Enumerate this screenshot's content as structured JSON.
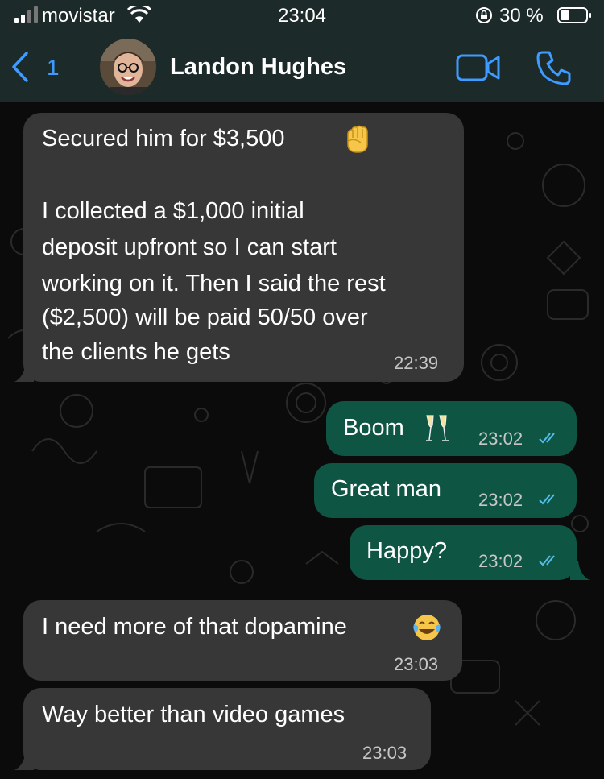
{
  "status_bar": {
    "carrier": "movistar",
    "time": "23:04",
    "battery": "30 %"
  },
  "header": {
    "back_count": "1",
    "contact_name": "Landon Hughes"
  },
  "messages": [
    {
      "direction": "in",
      "lines": [
        "Secured him for $3,500"
      ],
      "emoji": "raised-fist-emoji"
    },
    {
      "direction": "in",
      "lines": [
        "I collected a $1,000 initial",
        "deposit upfront so I can start",
        "working on it. Then I said the rest",
        "($2,500) will be paid 50/50 over",
        "the clients he gets"
      ],
      "time": "22:39"
    },
    {
      "direction": "out",
      "text": "Boom",
      "emoji": "champagne-glasses-emoji",
      "time": "23:02",
      "status": "read"
    },
    {
      "direction": "out",
      "text": "Great man",
      "time": "23:02",
      "status": "read"
    },
    {
      "direction": "out",
      "text": "Happy?",
      "time": "23:02",
      "status": "read"
    },
    {
      "direction": "in",
      "text": "I need more of that dopamine",
      "emoji": "tears-of-joy-emoji",
      "time": "23:03"
    },
    {
      "direction": "in",
      "text": "Way better than video games",
      "time": "23:03"
    }
  ],
  "colors": {
    "incoming_bubble": "#373737",
    "outgoing_bubble": "#0f5544",
    "read_ticks": "#53bdeb",
    "accent": "#3e9bff",
    "header_bg": "#1c2a2a"
  }
}
